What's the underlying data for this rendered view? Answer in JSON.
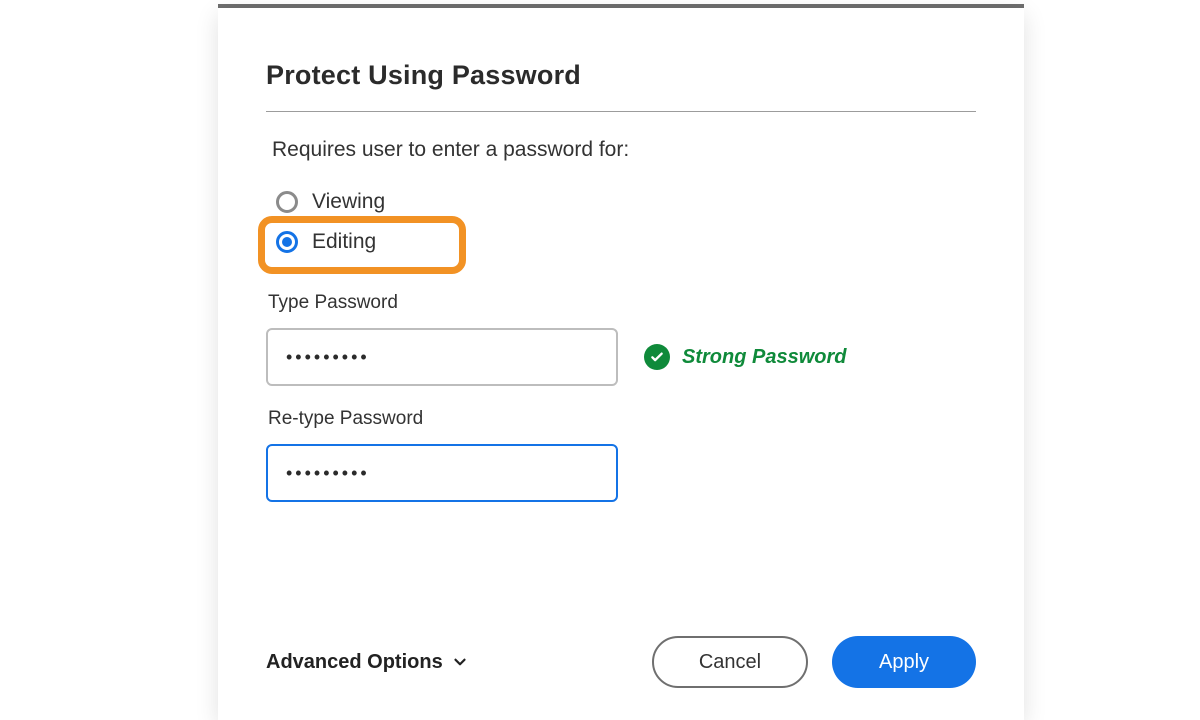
{
  "dialog": {
    "title": "Protect Using Password",
    "requires_label": "Requires user to enter a password for:",
    "radios": {
      "viewing": "Viewing",
      "editing": "Editing",
      "selected": "editing"
    },
    "type_password_label": "Type Password",
    "retype_password_label": "Re-type Password",
    "password_masked": "•••••••••",
    "retype_masked": "•••••••••",
    "strength_text": "Strong Password",
    "advanced_label": "Advanced Options",
    "cancel_label": "Cancel",
    "apply_label": "Apply"
  },
  "colors": {
    "accent": "#1473e6",
    "highlight": "#f29224",
    "success": "#0f8a3a"
  }
}
